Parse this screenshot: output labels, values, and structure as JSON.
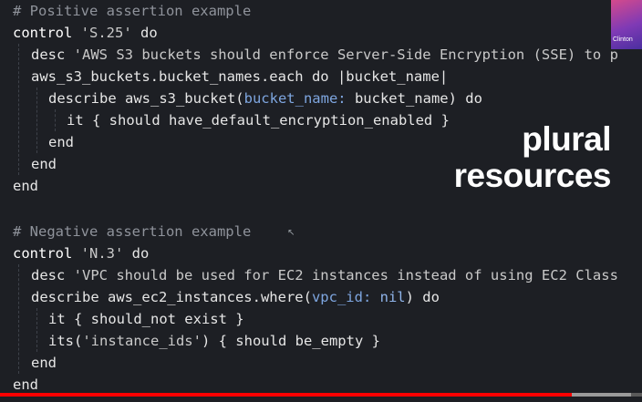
{
  "code": {
    "l1": "# Positive assertion example",
    "l2_kw": "control ",
    "l2_str": "'S.25'",
    "l2_end": " do",
    "l3_kw": "desc ",
    "l3_str": "'AWS S3 buckets should enforce Server-Side Encryption (SSE) to p",
    "l4": "aws_s3_buckets.bucket_names.each do |bucket_name|",
    "l5_a": "describe aws_s3_bucket(",
    "l5_sym": "bucket_name:",
    "l5_b": " bucket_name) do",
    "l6": "it { should have_default_encryption_enabled }",
    "l7": "end",
    "l8": "end",
    "l9": "end",
    "l11": "# Negative assertion example",
    "l12_kw": "control ",
    "l12_str": "'N.3'",
    "l12_end": " do",
    "l13_kw": "desc ",
    "l13_str": "'VPC should be used for EC2 instances instead of using EC2 Class",
    "l14_a": "describe aws_ec2_instances.where(",
    "l14_sym": "vpc_id:",
    "l14_nil": " nil",
    "l14_b": ") do",
    "l15": "it { should_not exist }",
    "l16_a": "its(",
    "l16_str": "'instance_ids'",
    "l16_b": ") { should be_empty }",
    "l17": "end",
    "l18": "end"
  },
  "overlay": {
    "line1": "plural",
    "line2": "resources"
  },
  "avatar": {
    "name": "Clinton"
  },
  "video": {
    "progress_fraction": 0.89
  },
  "colors": {
    "background": "#1d1f24",
    "progress": "#ff0000",
    "avatar_gradient": "#d44a8c"
  }
}
